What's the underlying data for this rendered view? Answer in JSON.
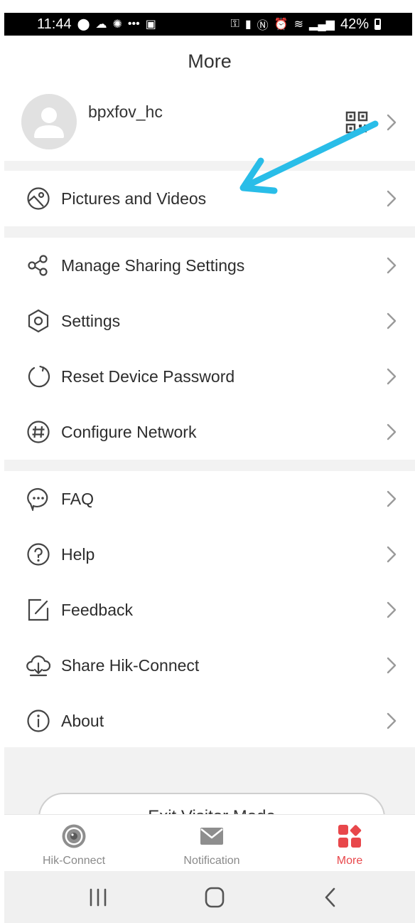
{
  "status_bar": {
    "time": "11:44",
    "dots": "•••",
    "battery": "42%"
  },
  "header": {
    "title": "More"
  },
  "profile": {
    "username": "bpxfov_hc"
  },
  "menu_groups": [
    [
      {
        "label": "Pictures and Videos",
        "icon": "image-icon"
      }
    ],
    [
      {
        "label": "Manage Sharing Settings",
        "icon": "share-icon"
      },
      {
        "label": "Settings",
        "icon": "settings-icon"
      },
      {
        "label": "Reset Device Password",
        "icon": "reset-icon"
      },
      {
        "label": "Configure Network",
        "icon": "network-icon"
      }
    ],
    [
      {
        "label": "FAQ",
        "icon": "faq-icon"
      },
      {
        "label": "Help",
        "icon": "help-icon"
      },
      {
        "label": "Feedback",
        "icon": "feedback-icon"
      },
      {
        "label": "Share Hik-Connect",
        "icon": "cloud-download-icon"
      },
      {
        "label": "About",
        "icon": "info-icon"
      }
    ]
  ],
  "exit_button": {
    "label": "Exit Visitor Mode"
  },
  "tabs": [
    {
      "label": "Hik-Connect",
      "icon": "camera-icon",
      "active": false
    },
    {
      "label": "Notification",
      "icon": "envelope-icon",
      "active": false
    },
    {
      "label": "More",
      "icon": "apps-icon",
      "active": true
    }
  ],
  "colors": {
    "accent": "#e8474b",
    "arrow": "#29bde8",
    "divider": "#f2f2f2",
    "icon": "#444444"
  }
}
